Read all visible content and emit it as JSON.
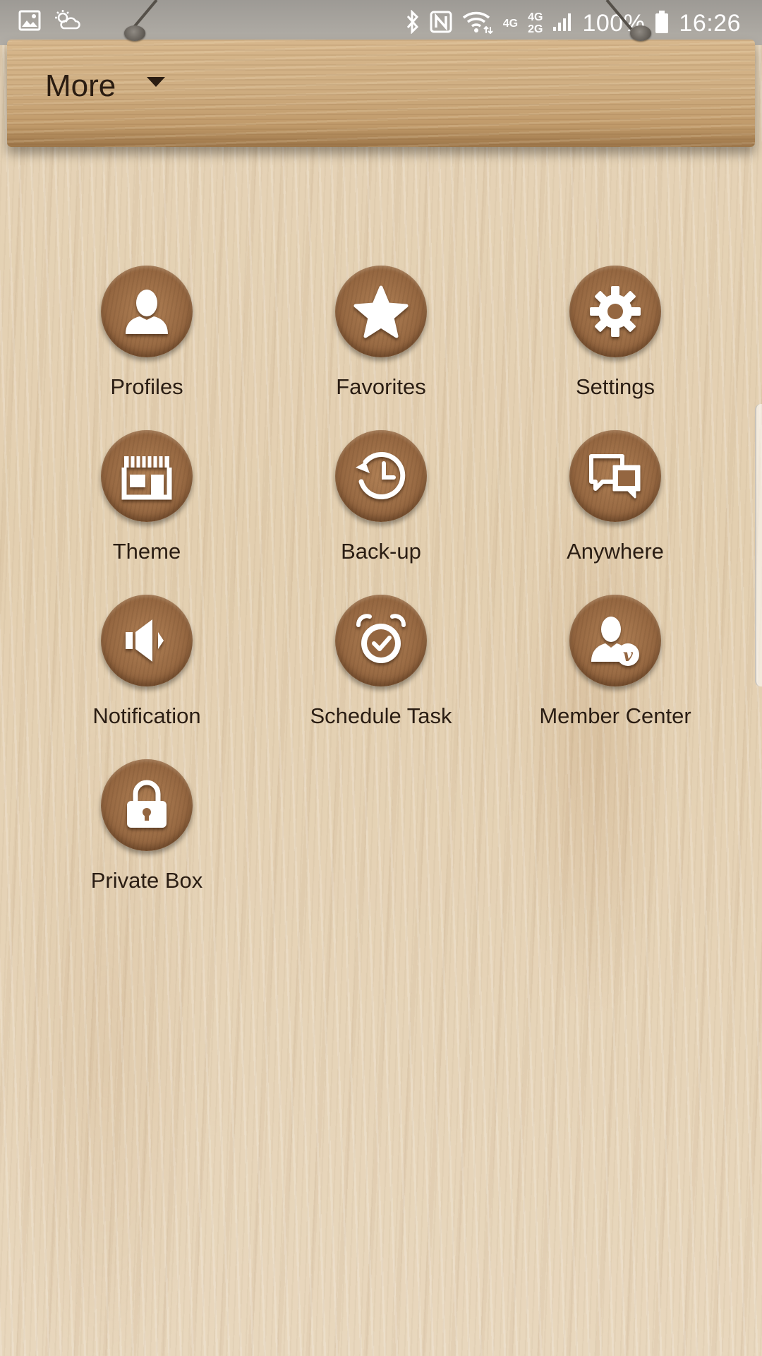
{
  "status_bar": {
    "battery": "100%",
    "time": "16:26",
    "network_4g": "4G",
    "network_4g_2": "4G",
    "network_2g": "2G"
  },
  "header": {
    "title": "More"
  },
  "menu": {
    "items": [
      {
        "label": "Profiles",
        "icon": "profile-icon"
      },
      {
        "label": "Favorites",
        "icon": "star-icon"
      },
      {
        "label": "Settings",
        "icon": "gear-icon"
      },
      {
        "label": "Theme",
        "icon": "storefront-icon"
      },
      {
        "label": "Back-up",
        "icon": "history-icon"
      },
      {
        "label": "Anywhere",
        "icon": "chat-bubbles-icon"
      },
      {
        "label": "Notification",
        "icon": "speaker-icon"
      },
      {
        "label": "Schedule Task",
        "icon": "alarm-clock-icon"
      },
      {
        "label": "Member Center",
        "icon": "member-icon"
      },
      {
        "label": "Private Box",
        "icon": "lock-icon"
      }
    ]
  },
  "colors": {
    "wood_background": "#e5d2b5",
    "button_wood": "#946640",
    "label_text": "#2a1d13"
  }
}
